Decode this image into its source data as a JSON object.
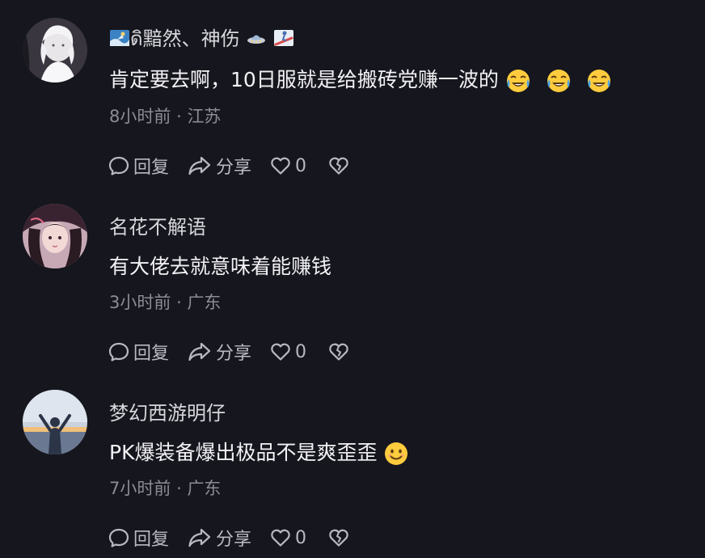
{
  "comments": [
    {
      "username": "ดิ黯然、神伤",
      "text": "肯定要去啊，10日服就是给搬砖党赚一波的",
      "emojis": [
        "tears-of-joy-emoji",
        "tears-of-joy-emoji",
        "tears-of-joy-emoji"
      ],
      "time": "8小时前",
      "location": "江苏",
      "reply_label": "回复",
      "share_label": "分享",
      "like_count": "0"
    },
    {
      "username": "名花不解语",
      "text": "有大佬去就意味着能赚钱",
      "emojis": [],
      "time": "3小时前",
      "location": "广东",
      "reply_label": "回复",
      "share_label": "分享",
      "like_count": "0"
    },
    {
      "username": "梦幻西游明仔",
      "text": "PK爆装备爆出极品不是爽歪歪",
      "emojis": [
        "smiling-emoji"
      ],
      "time": "7小时前",
      "location": "广东",
      "reply_label": "回复",
      "share_label": "分享",
      "like_count": "0"
    }
  ],
  "meta_separator": "·",
  "colors": {
    "background": "#16161e",
    "text_primary": "#f2f2f5",
    "text_secondary": "#8c8c96",
    "icon": "#b9b9c1"
  }
}
